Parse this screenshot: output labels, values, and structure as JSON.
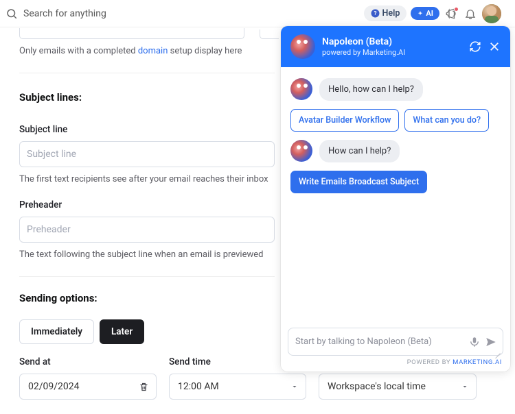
{
  "topbar": {
    "search_placeholder": "Search for anything",
    "help_label": "Help",
    "ai_label": "AI"
  },
  "email_section": {
    "truncated_email_value": "",
    "domain_note_prefix": "Only emails with a completed ",
    "domain_link": "domain",
    "domain_note_suffix": " setup display here"
  },
  "subject_section": {
    "heading": "Subject lines:",
    "subject_label": "Subject line",
    "subject_placeholder": "Subject line",
    "subject_helper": "The first text recipients see after your email reaches their inbox",
    "preheader_label": "Preheader",
    "preheader_placeholder": "Preheader",
    "preheader_helper": "The text following the subject line when an email is previewed"
  },
  "sending": {
    "heading": "Sending options:",
    "immediately": "Immediately",
    "later": "Later",
    "send_at_label": "Send at",
    "send_at_value": "02/09/2024",
    "send_time_label": "Send time",
    "send_time_value": "12:00 AM",
    "tz_value": "Workspace's local time"
  },
  "chat": {
    "title": "Napoleon (Beta)",
    "subtitle": "powered by Marketing.AI",
    "msg1": "Hello, how can I help?",
    "suggest1": "Avatar Builder Workflow",
    "suggest2": "What can you do?",
    "msg2": "How can I help?",
    "action1": "Write Emails Broadcast Subject",
    "input_placeholder": "Start by talking to Napoleon (Beta)",
    "footer_prefix": "POWERED BY ",
    "footer_brand": "MARKETING.AI"
  }
}
